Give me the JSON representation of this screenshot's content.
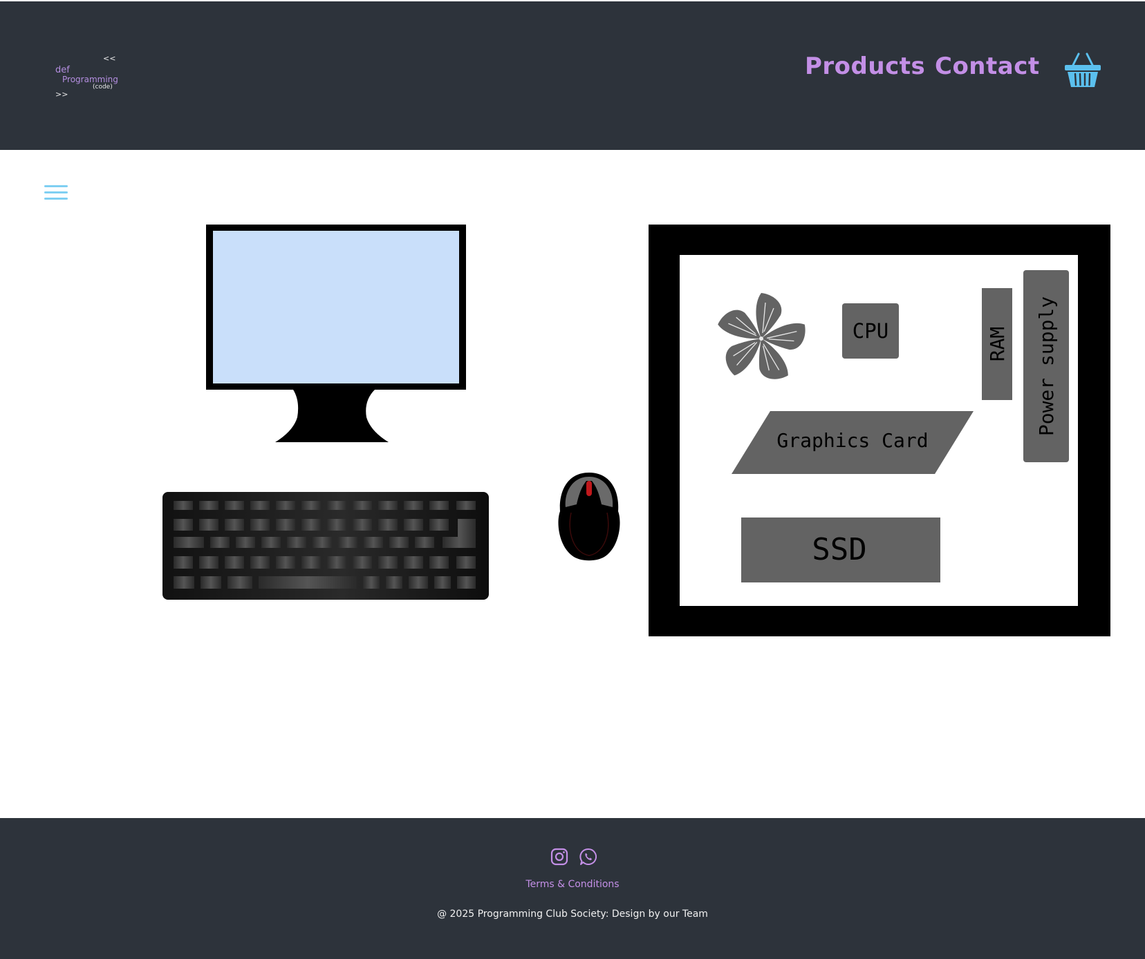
{
  "header": {
    "logo": {
      "open": "<<",
      "keyword": "def",
      "name": "Programming",
      "sub": "(code)",
      "close": ">>"
    },
    "nav": [
      {
        "label": "Products"
      },
      {
        "label": "Contact"
      }
    ],
    "cart_icon": "basket-icon"
  },
  "menu_icon": "hamburger-menu-icon",
  "scene": {
    "computer_case": {
      "components": [
        "CPU",
        "RAM",
        "Power supply",
        "Graphics Card",
        "SSD"
      ]
    }
  },
  "footer": {
    "social": [
      "instagram-icon",
      "whatsapp-icon"
    ],
    "terms_link": "Terms & Conditions",
    "copyright": "@ 2025 Programming Club Society: Design by our Team"
  },
  "colors": {
    "header_bg": "#2d333b",
    "accent": "#c38fe6",
    "icon_blue": "#5bc0ee",
    "screen": "#c9dffa",
    "component_gray": "#636363"
  }
}
